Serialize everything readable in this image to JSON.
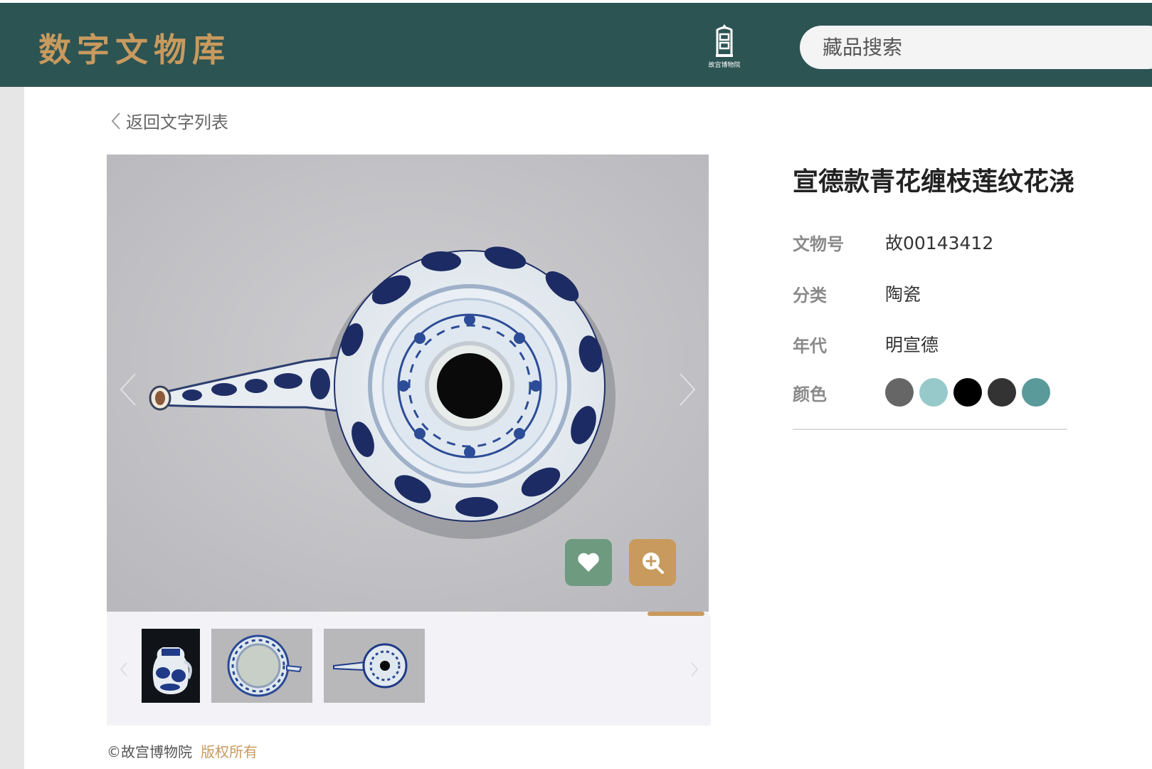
{
  "header": {
    "site_title": "数字文物库",
    "logo_caption": "故宫博物院",
    "search_placeholder": "藏品搜索"
  },
  "nav": {
    "back_label": "返回文字列表"
  },
  "artifact": {
    "title": "宣德款青花缠枝莲纹花浇",
    "fields": [
      {
        "label": "文物号",
        "value": "故00143412"
      },
      {
        "label": "分类",
        "value": "陶瓷"
      },
      {
        "label": "年代",
        "value": "明宣德"
      },
      {
        "label": "颜色"
      }
    ],
    "colors": [
      "#666666",
      "#97c9cb",
      "#000000",
      "#333333",
      "#5a9a9a"
    ]
  },
  "viewer": {
    "like_icon": "heart-icon",
    "zoom_icon": "zoom-in-icon",
    "thumbnails": [
      "front view",
      "top inside view",
      "top spout view"
    ],
    "selected_thumbnail": 3
  },
  "footer": {
    "copyright": "©故宫博物院",
    "rights": "版权所有"
  },
  "theme": {
    "header_bg": "#2c5453",
    "accent_gold": "#c89a5e",
    "like_green": "#6e9a80"
  }
}
